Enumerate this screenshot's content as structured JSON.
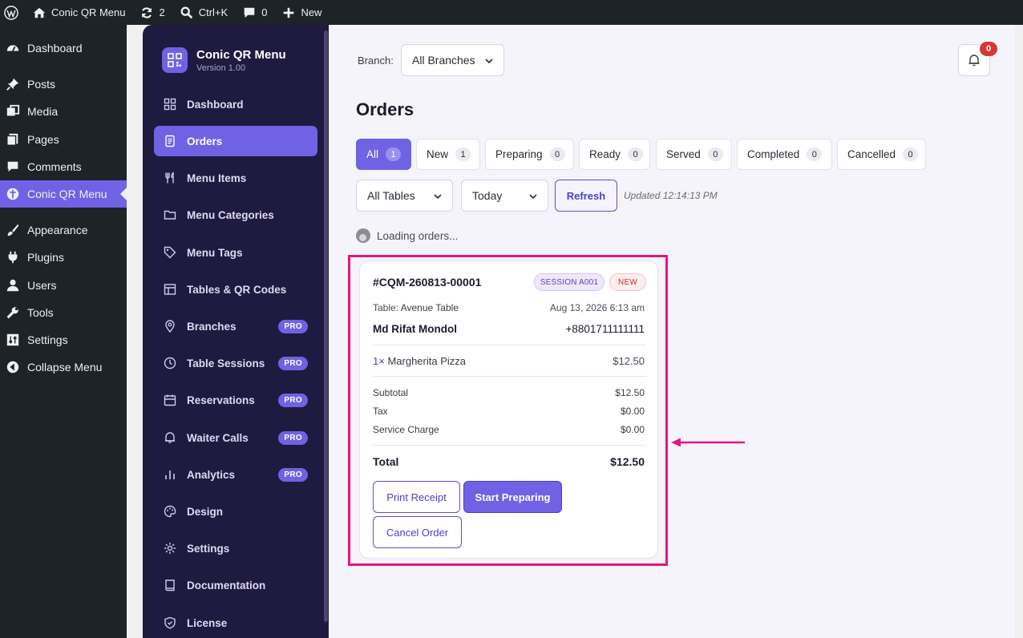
{
  "adminbar": {
    "site_name": "Conic QR Menu",
    "updates_count": "2",
    "search_shortcut": "Ctrl+K",
    "comments_count": "0",
    "new_label": "New"
  },
  "wp_menu": {
    "items": [
      {
        "label": "Dashboard",
        "icon": "dashboard-icon"
      },
      {
        "label": "Posts",
        "icon": "pin-icon"
      },
      {
        "label": "Media",
        "icon": "media-icon"
      },
      {
        "label": "Pages",
        "icon": "pages-icon"
      },
      {
        "label": "Comments",
        "icon": "comment-icon"
      },
      {
        "label": "Conic QR Menu",
        "icon": "conic-icon"
      },
      {
        "label": "Appearance",
        "icon": "brush-icon"
      },
      {
        "label": "Plugins",
        "icon": "plug-icon"
      },
      {
        "label": "Users",
        "icon": "user-icon"
      },
      {
        "label": "Tools",
        "icon": "wrench-icon"
      },
      {
        "label": "Settings",
        "icon": "sliders-icon"
      },
      {
        "label": "Collapse Menu",
        "icon": "collapse-icon"
      }
    ],
    "active": "Conic QR Menu"
  },
  "plugin": {
    "name": "Conic QR Menu",
    "version": "Version 1.00",
    "nav": [
      {
        "label": "Dashboard",
        "icon": "grid-icon",
        "pro": ""
      },
      {
        "label": "Orders",
        "icon": "receipt-icon",
        "pro": ""
      },
      {
        "label": "Menu Items",
        "icon": "utensils-icon",
        "pro": ""
      },
      {
        "label": "Menu Categories",
        "icon": "folder-icon",
        "pro": ""
      },
      {
        "label": "Menu Tags",
        "icon": "tag-icon",
        "pro": ""
      },
      {
        "label": "Tables & QR Codes",
        "icon": "table-icon",
        "pro": ""
      },
      {
        "label": "Branches",
        "icon": "map-pin-icon",
        "pro": "PRO"
      },
      {
        "label": "Table Sessions",
        "icon": "clock-icon",
        "pro": "PRO"
      },
      {
        "label": "Reservations",
        "icon": "calendar-icon",
        "pro": "PRO"
      },
      {
        "label": "Waiter Calls",
        "icon": "bell-icon",
        "pro": "PRO"
      },
      {
        "label": "Analytics",
        "icon": "bar-chart-icon",
        "pro": "PRO"
      },
      {
        "label": "Design",
        "icon": "palette-icon",
        "pro": ""
      },
      {
        "label": "Settings",
        "icon": "gear-icon",
        "pro": ""
      },
      {
        "label": "Documentation",
        "icon": "book-icon",
        "pro": ""
      },
      {
        "label": "License",
        "icon": "shield-icon",
        "pro": ""
      }
    ],
    "active": "Orders"
  },
  "header": {
    "branch_label": "Branch:",
    "branch_value": "All Branches",
    "notifications_count": "0"
  },
  "orders": {
    "title": "Orders",
    "tabs": [
      {
        "label": "All",
        "count": "1"
      },
      {
        "label": "New",
        "count": "1"
      },
      {
        "label": "Preparing",
        "count": "0"
      },
      {
        "label": "Ready",
        "count": "0"
      },
      {
        "label": "Served",
        "count": "0"
      },
      {
        "label": "Completed",
        "count": "0"
      },
      {
        "label": "Cancelled",
        "count": "0"
      }
    ],
    "active_tab": "All",
    "table_filter": "All Tables",
    "date_filter": "Today",
    "refresh_label": "Refresh",
    "updated_text": "Updated 12:14:13 PM",
    "loading_text": "Loading orders..."
  },
  "order_card": {
    "order_id": "#CQM-260813-00001",
    "session_badge": "SESSION A001",
    "status_badge": "NEW",
    "table_label": "Table:",
    "table_name": "Avenue Table",
    "date": "Aug 13, 2026 6:13 am",
    "customer_name": "Md Rifat Mondol",
    "customer_phone": "+8801711111111",
    "item_qty": "1×",
    "item_name": "Margherita Pizza",
    "item_price": "$12.50",
    "subtotal_label": "Subtotal",
    "subtotal": "$12.50",
    "tax_label": "Tax",
    "tax": "$0.00",
    "service_label": "Service Charge",
    "service": "$0.00",
    "total_label": "Total",
    "total": "$12.50",
    "print_label": "Print Receipt",
    "start_label": "Start Preparing",
    "cancel_label": "Cancel Order"
  },
  "colors": {
    "accent": "#7062e5",
    "sidebar": "#1f1a40",
    "highlight": "#e6157f",
    "badge_red": "#d63638"
  }
}
